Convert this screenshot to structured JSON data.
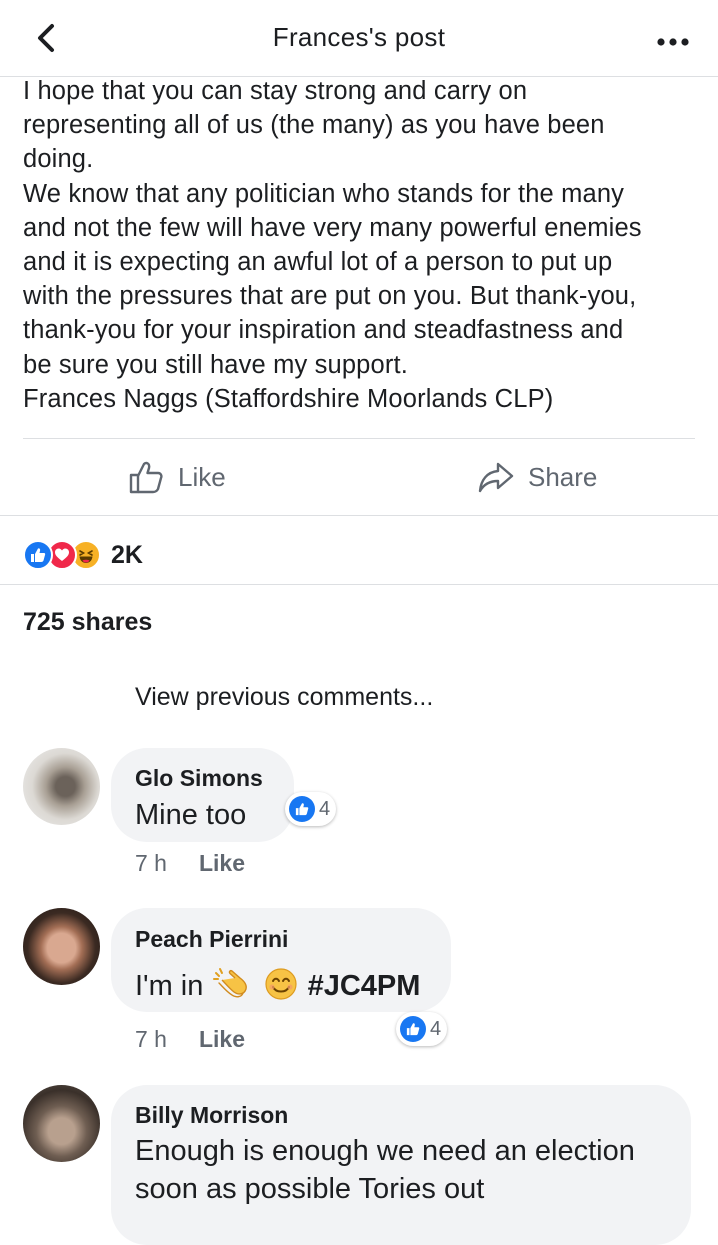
{
  "header": {
    "title": "Frances's post"
  },
  "post": {
    "lines": [
      "I hope that you can stay strong and carry on",
      "representing all of us (the many) as you have been",
      "doing.",
      "We know that any politician who stands for the many",
      "and not the few will have very many powerful enemies",
      "and it is expecting an awful lot of a person to put up",
      "with the pressures that are put on you. But thank-you,",
      "thank-you for your inspiration and steadfastness and",
      "be sure you still have my support.",
      "Frances Naggs (Staffordshire Moorlands CLP)"
    ]
  },
  "actions": {
    "like": "Like",
    "share": "Share"
  },
  "reactions": {
    "count": "2K",
    "icons": [
      "like-icon",
      "love-icon",
      "haha-icon"
    ]
  },
  "shares": "725 shares",
  "view_previous": "View previous comments...",
  "comments": [
    {
      "name": "Glo Simons",
      "text": "Mine too",
      "time": "7 h",
      "like_label": "Like",
      "likes": "4"
    },
    {
      "name": "Peach Pierrini",
      "text": "I'm in",
      "emojis": [
        "clapping-hands-icon",
        "smiling-face-icon"
      ],
      "hashtag": "#JC4PM",
      "time": "7 h",
      "like_label": "Like",
      "likes": "4"
    },
    {
      "name": "Billy Morrison",
      "text_lines": [
        "Enough is enough we need an election",
        "soon as possible Tories out"
      ]
    }
  ],
  "colors": {
    "brand_blue": "#1877f2",
    "love_red": "#f0284a",
    "haha_yellow": "#f7b125",
    "bubble_bg": "#f2f3f5",
    "secondary_text": "#606770",
    "divider": "#dddfe2"
  }
}
